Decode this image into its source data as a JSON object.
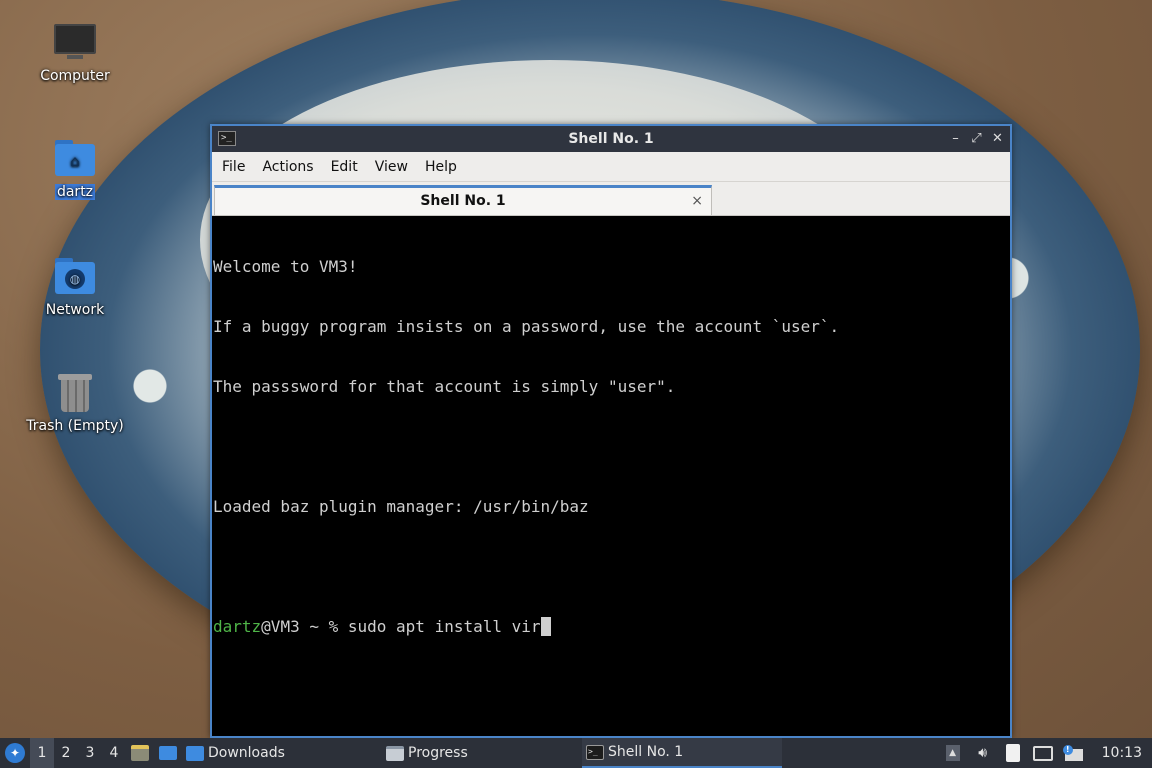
{
  "desktop": {
    "icons": [
      {
        "label": "Computer",
        "icon": "computer-icon"
      },
      {
        "label": "dartz",
        "icon": "home-folder-icon"
      },
      {
        "label": "Network",
        "icon": "network-folder-icon"
      },
      {
        "label": "Trash (Empty)",
        "icon": "trash-icon"
      }
    ]
  },
  "window": {
    "title": "Shell No. 1",
    "controls": {
      "minimize": "–",
      "maximize": "⤢",
      "close": "✕"
    },
    "menu": [
      "File",
      "Actions",
      "Edit",
      "View",
      "Help"
    ],
    "tab": {
      "label": "Shell No. 1",
      "close": "×"
    },
    "terminal": {
      "lines": [
        "Welcome to VM3!",
        "If a buggy program insists on a password, use the account `user`.",
        "The passsword for that account is simply \"user\".",
        "",
        "Loaded baz plugin manager: /usr/bin/baz",
        ""
      ],
      "prompt_user": "dartz",
      "prompt_rest": "@VM3 ~ % ",
      "command": "sudo apt install vir"
    }
  },
  "taskbar": {
    "workspaces": [
      "1",
      "2",
      "3",
      "4"
    ],
    "active_workspace": "1",
    "tasks": [
      {
        "label": "Downloads",
        "icon": "folder-icon"
      },
      {
        "label": "Progress",
        "icon": "progress-window-icon"
      },
      {
        "label": "Shell No. 1",
        "icon": "terminal-icon"
      }
    ],
    "clock": "10:13"
  },
  "colors": {
    "accent": "#4a84c8",
    "prompt_user": "#4fb548",
    "terminal_bg": "#000000",
    "titlebar_bg": "#2f343f",
    "taskbar_bg": "#2c3039"
  }
}
